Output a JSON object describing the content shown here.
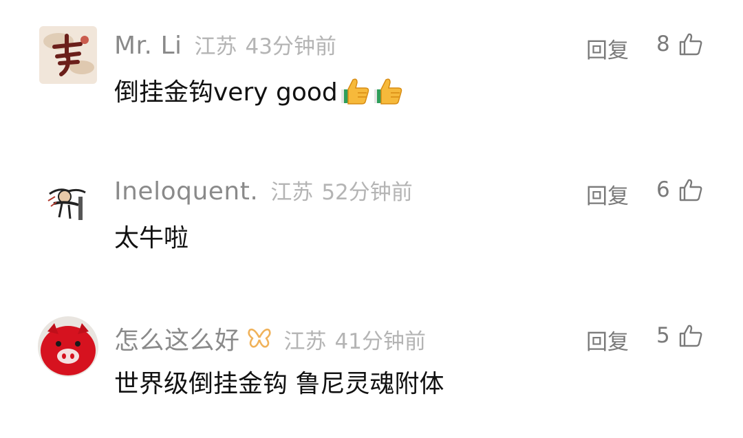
{
  "comments": [
    {
      "username": "Mr. Li",
      "location": "江苏",
      "time": "43分钟前",
      "reply_label": "回复",
      "likes": "8",
      "text": "倒挂金钩very good",
      "trailing_emoji": [
        "thumbs-up-emoji",
        "thumbs-up-emoji"
      ],
      "avatar": "calligraphy-li-avatar"
    },
    {
      "username": "Ineloquent.",
      "location": "江苏",
      "time": "52分钟前",
      "reply_label": "回复",
      "likes": "6",
      "text": "太牛啦",
      "avatar": "sketch-character-avatar"
    },
    {
      "username": "怎么这么好",
      "location": "江苏",
      "time": "41分钟前",
      "reply_label": "回复",
      "likes": "5",
      "text": "世界级倒挂金钩 鲁尼灵魂附体",
      "avatar": "red-pig-avatar",
      "badge": "butterfly-badge-icon"
    }
  ],
  "colors": {
    "username": "#8a8a8a",
    "meta": "#b4b4b4",
    "action": "#7a7a7a",
    "content": "#111111",
    "badge": "#f0b25a"
  }
}
